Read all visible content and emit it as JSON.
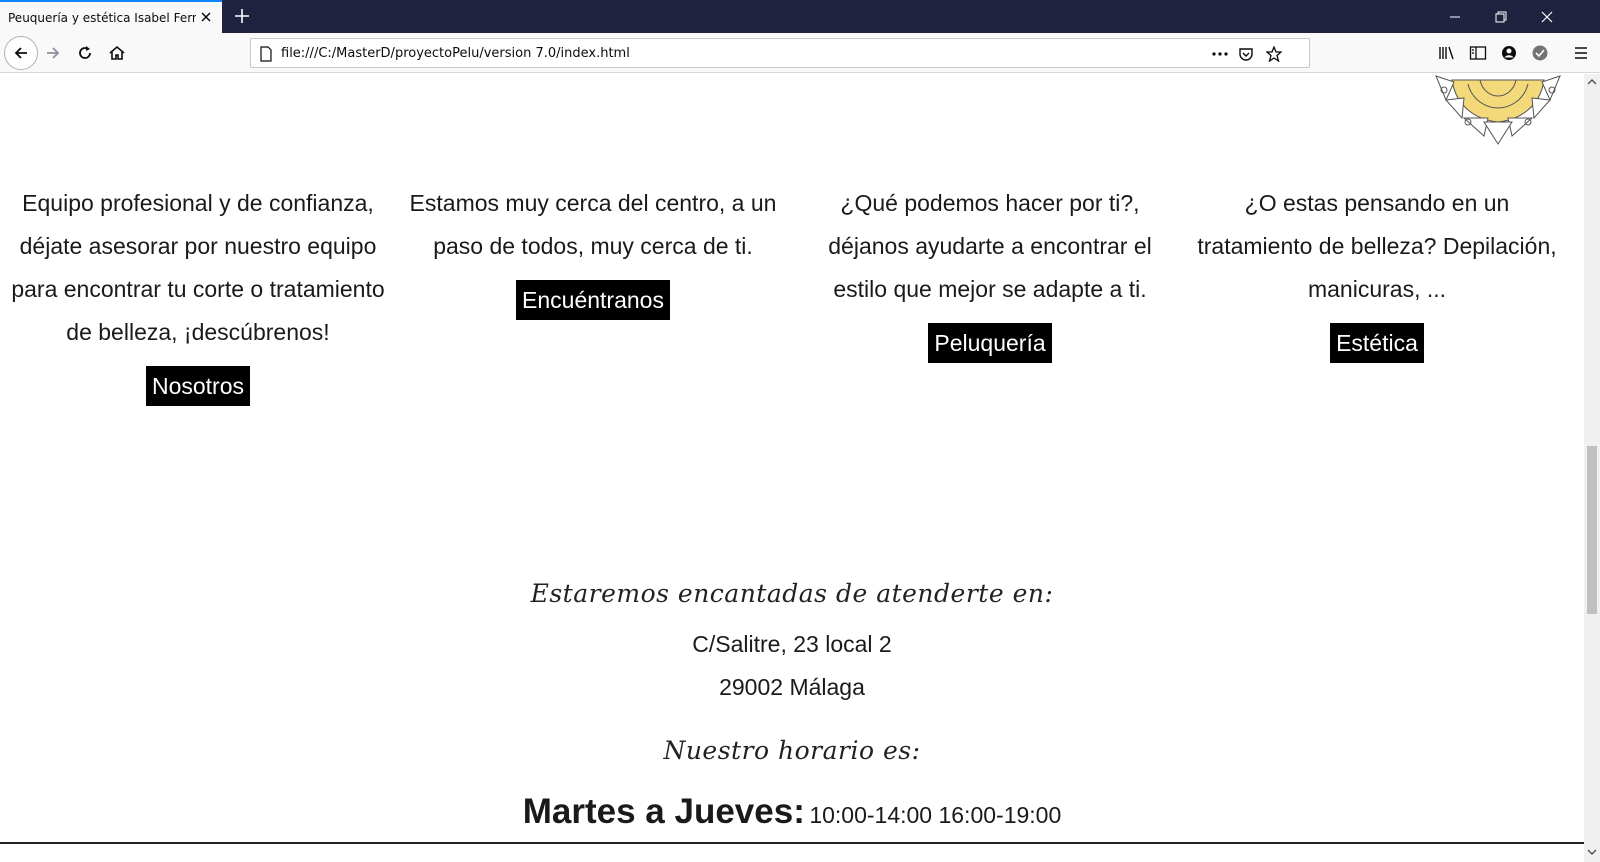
{
  "browser": {
    "tab_title": "Peuquería y estética Isabel Fernández",
    "url": "file:///C:/MasterD/proyectoPelu/version 7.0/index.html",
    "accent": "#0a84ff",
    "tabbar_bg": "#202340"
  },
  "columns": [
    {
      "text": "Equipo profesional y de confianza, déjate asesorar por nuestro equipo para encontrar tu corte o tratamiento de belleza, ¡descúbrenos!",
      "button": "Nosotros"
    },
    {
      "text": "Estamos muy cerca del centro, a un paso de todos, muy cerca de ti.",
      "button": "Encuéntranos"
    },
    {
      "text": "¿Qué podemos hacer por ti?, déjanos ayudarte a encontrar el estilo que mejor se adapte a ti.",
      "button": "Peluquería"
    },
    {
      "text": "¿O estas pensando en un tratamiento de belleza? Depilación, manicuras, ...",
      "button": "Estética"
    }
  ],
  "contact": {
    "heading": "Estaremos encantadas de atenderte en:",
    "street": "C/Salitre, 23 local 2",
    "city": "29002 Málaga"
  },
  "schedule": {
    "heading": "Nuestro horario es:",
    "days": "Martes a Jueves:",
    "times": "10:00-14:00 16:00-19:00"
  }
}
